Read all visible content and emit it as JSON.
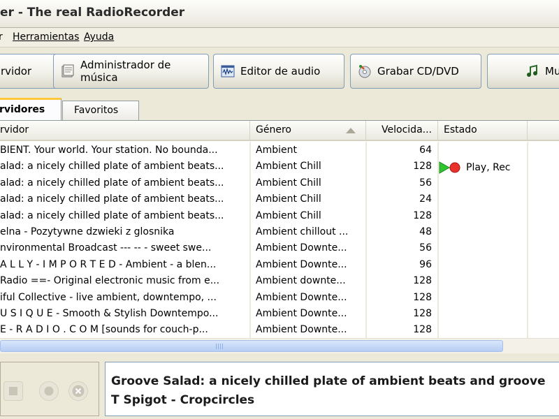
{
  "window": {
    "title": "er - The real RadioRecorder"
  },
  "menu": [
    {
      "label": "r",
      "underline": ""
    },
    {
      "label": "Herramientas",
      "underline": "H"
    },
    {
      "label": "Ayuda",
      "underline": "A"
    }
  ],
  "toolbar": {
    "servidor_label": "rvidor",
    "admin_label_line1": "Administrador de",
    "admin_label_line2": "música",
    "editor_label": "Editor de audio",
    "grabar_label": "Grabar CD/DVD",
    "mu_label": "Mu"
  },
  "tabs": {
    "servidores": "rvidores",
    "favoritos": "Favoritos"
  },
  "table": {
    "columns": {
      "servidor": "rvidor",
      "genero": "Género",
      "velocidad": "Velocida...",
      "estado": "Estado"
    },
    "sort_column": "genero",
    "rows": [
      {
        "servidor": "BIENT. Your world. Your station. No bounda...",
        "genero": "Ambient",
        "velocidad": "64",
        "estado": ""
      },
      {
        "servidor": "alad: a nicely chilled plate of ambient beats...",
        "genero": "Ambient Chill",
        "velocidad": "128",
        "estado": "Play, Rec"
      },
      {
        "servidor": "alad: a nicely chilled plate of ambient beats...",
        "genero": "Ambient Chill",
        "velocidad": "56",
        "estado": ""
      },
      {
        "servidor": "alad: a nicely chilled plate of ambient beats...",
        "genero": "Ambient Chill",
        "velocidad": "24",
        "estado": ""
      },
      {
        "servidor": "alad: a nicely chilled plate of ambient beats...",
        "genero": "Ambient Chill",
        "velocidad": "128",
        "estado": ""
      },
      {
        "servidor": "elna - Pozytywne dzwieki z glosnika",
        "genero": "Ambient chillout ...",
        "velocidad": "48",
        "estado": ""
      },
      {
        "servidor": "nvironmental Broadcast --- -- - sweet swe...",
        "genero": "Ambient Downte...",
        "velocidad": "56",
        "estado": ""
      },
      {
        "servidor": "A L L Y - I M P O R T E D - Ambient - a blen...",
        "genero": "Ambient Downte...",
        "velocidad": "96",
        "estado": ""
      },
      {
        "servidor": "Radio ==- Original electronic music from e...",
        "genero": "Ambient downte...",
        "velocidad": "128",
        "estado": ""
      },
      {
        "servidor": "iful Collective - live ambient, downtempo, ...",
        "genero": "Ambient Downte...",
        "velocidad": "128",
        "estado": ""
      },
      {
        "servidor": "U S I Q U E - Smooth & Stylish Downtempo...",
        "genero": "Ambient Downte...",
        "velocidad": "128",
        "estado": ""
      },
      {
        "servidor": "E - R A D I O . C O M [sounds for couch-p...",
        "genero": "Ambient Downte...",
        "velocidad": "128",
        "estado": ""
      }
    ]
  },
  "now_playing": {
    "station": "Groove Salad: a nicely chilled plate of ambient beats and groove",
    "track": "T Spigot - Cropcircles"
  },
  "colors": {
    "play": "#2fc52f",
    "record": "#e8322b",
    "accent_tab": "#ffc83c"
  }
}
